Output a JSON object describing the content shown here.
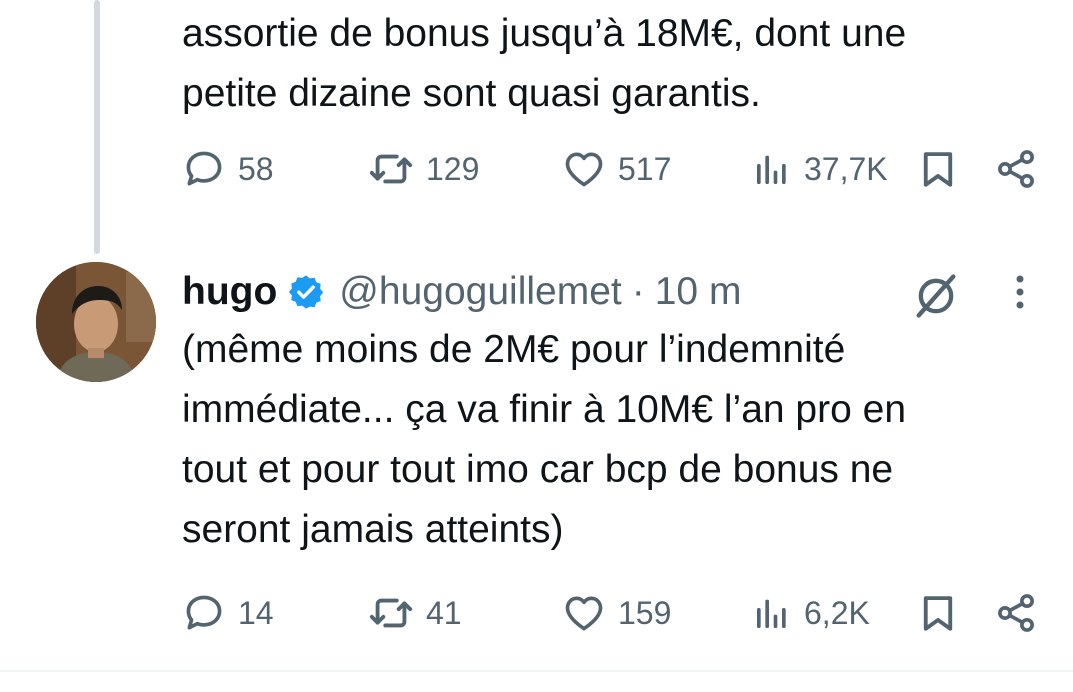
{
  "previous_tweet": {
    "text": "assortie de bonus jusqu’à 18M€, dont une\npetite dizaine sont quasi garantis.",
    "actions": {
      "replies": "58",
      "retweets": "129",
      "likes": "517",
      "views": "37,7K"
    }
  },
  "reply_tweet": {
    "author": {
      "display_name": "hugo",
      "handle": "@hugoguillemet",
      "separator": "·",
      "time": "10 m"
    },
    "text": "(même moins de 2M€ pour l’indemnité\nimmédiate... ça va finir à 10M€ l’an pro en\ntout et pour tout imo car bcp de bonus ne\nseront jamais atteints)",
    "actions": {
      "replies": "14",
      "retweets": "41",
      "likes": "159",
      "views": "6,2K"
    }
  },
  "icons": {
    "reply": "reply-icon",
    "retweet": "retweet-icon",
    "like": "heart-icon",
    "views": "views-icon",
    "bookmark": "bookmark-icon",
    "share": "share-icon",
    "verified": "verified-badge-icon",
    "grok": "grok-icon",
    "more": "more-vertical-icon"
  },
  "colors": {
    "text": "#0f1419",
    "secondary": "#536471",
    "verified": "#1d9bf0",
    "thread_line": "#cfd9de"
  }
}
